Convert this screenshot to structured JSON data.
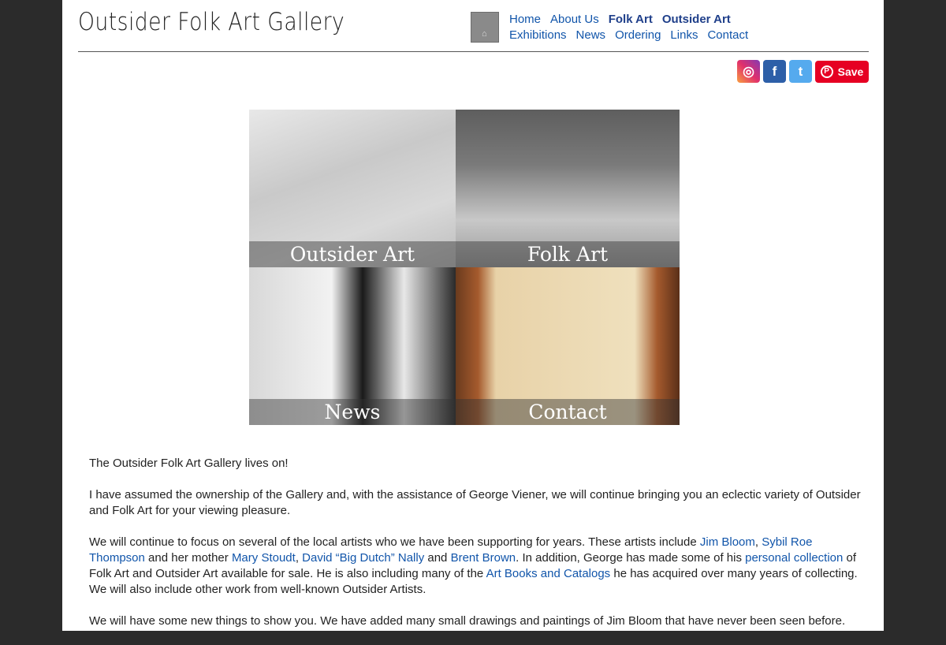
{
  "site": {
    "title": "Outsider Folk Art Gallery",
    "home_glyph": "⌂"
  },
  "nav": {
    "row1": [
      "Home",
      "About Us",
      "Folk Art",
      "Outsider Art"
    ],
    "row2": [
      "Exhibitions",
      "News",
      "Ordering",
      "Links",
      "Contact"
    ]
  },
  "social": {
    "instagram": "◎",
    "facebook": "f",
    "twitter": "t",
    "pinterest_label": "Save",
    "pinterest_glyph": "P"
  },
  "tiles": {
    "outsider_art": "Outsider Art",
    "folk_art": "Folk Art",
    "news": "News",
    "contact": "Contact"
  },
  "content": {
    "p1": "The Outsider Folk Art Gallery lives on!",
    "p2": "I have assumed the ownership of the Gallery and, with the assistance of George Viener, we will continue bringing you an eclectic variety of Outsider and Folk Art for your viewing pleasure.",
    "p3_a": "We will continue to focus on several of the local artists who we have been supporting for years. These artists include ",
    "link_jim": "Jim Bloom",
    "sep1": ", ",
    "link_sybil": "Sybil Roe Thompson",
    "p3_b": " and her mother ",
    "link_mary": "Mary Stoudt",
    "sep2": ", ",
    "link_david": "David “Big Dutch” Nally",
    "p3_c": " and ",
    "link_brent": "Brent Brown",
    "p3_d": ". In addition, George has made some of his ",
    "link_personal": "personal collection",
    "p3_e": " of Folk Art and Outsider Art available for sale. He is also including many of the ",
    "link_books": "Art Books and Catalogs",
    "p3_f": " he has acquired over many years of collecting. We will also include other work from well-known Outsider Artists.",
    "p4": "We will have some new things to show you.  We have added many small drawings and paintings of Jim Bloom that have never been seen before."
  }
}
